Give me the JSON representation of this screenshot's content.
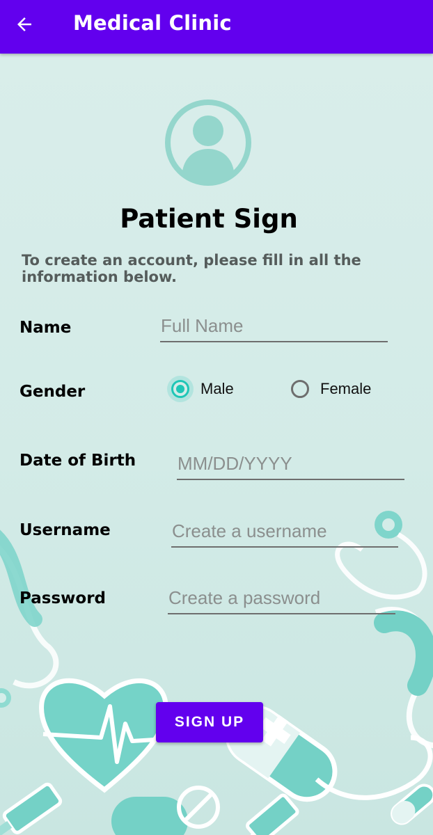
{
  "app_bar": {
    "title": "Medical Clinic",
    "back_icon": "arrow-left-icon",
    "color": "#6200ee"
  },
  "header": {
    "avatar_icon": "user-profile-icon",
    "title": "Patient Sign",
    "subtitle": "To create an account, please fill in all the information below."
  },
  "form": {
    "name": {
      "label": "Name",
      "placeholder": "Full Name",
      "value": ""
    },
    "gender": {
      "label": "Gender",
      "options": [
        {
          "label": "Male",
          "selected": true
        },
        {
          "label": "Female",
          "selected": false
        }
      ]
    },
    "dob": {
      "label": "Date of Birth",
      "placeholder": "MM/DD/YYYY",
      "value": ""
    },
    "username": {
      "label": "Username",
      "placeholder": "Create a username",
      "value": ""
    },
    "password": {
      "label": "Password",
      "placeholder": "Create a password",
      "value": ""
    }
  },
  "actions": {
    "signup_label": "SIGN UP"
  },
  "colors": {
    "accent": "#6200ee",
    "teal": "#1ec6b6",
    "background": "#d8eeeb"
  }
}
